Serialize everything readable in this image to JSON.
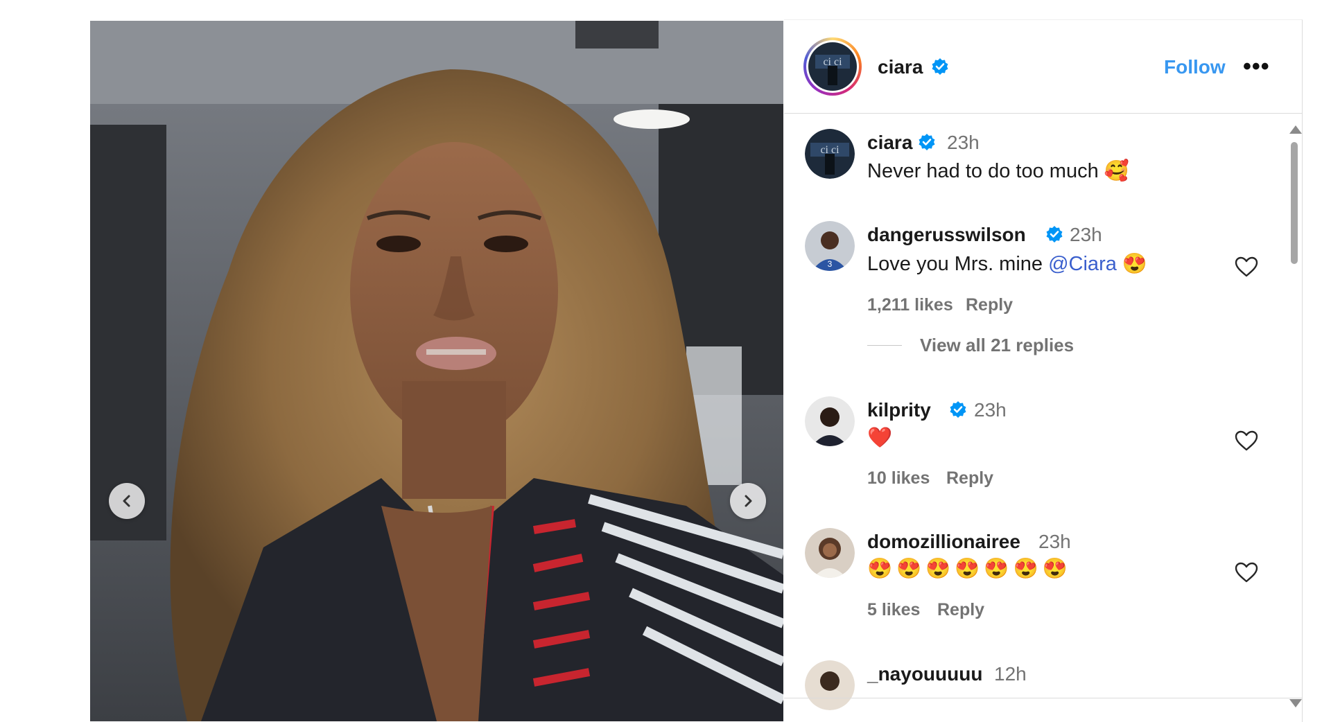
{
  "post": {
    "author": "ciara",
    "follow_label": "Follow",
    "more_label": "•••"
  },
  "comments": [
    {
      "user": "ciara",
      "time": "23h",
      "text": "Never had to do too much",
      "emoji": "🥰",
      "verified": true
    },
    {
      "user": "dangerusswilson",
      "time": "23h",
      "text": "Love you Mrs. mine",
      "mention": "@Ciara",
      "emoji": "😍",
      "verified": true,
      "likes": "1,211 likes",
      "reply": "Reply",
      "view_replies": "View all 21 replies"
    },
    {
      "user": "kilprity",
      "time": "23h",
      "emoji": "❤️",
      "verified": true,
      "likes": "10 likes",
      "reply": "Reply"
    },
    {
      "user": "domozillionairee",
      "time": "23h",
      "emoji": "😍😍😍😍😍😍😍",
      "verified": false,
      "likes": "5 likes",
      "reply": "Reply"
    },
    {
      "user": "_nayouuuuu",
      "time": "12h",
      "verified": false
    }
  ],
  "colors": {
    "accent": "#3897f0",
    "verified": "#0095f6",
    "muted": "#737373",
    "border": "#dbdbdb",
    "mention": "#3a5fcd"
  },
  "icons": {
    "verified": "verified-badge-icon",
    "heart": "heart-outline-icon",
    "prev": "chevron-left-icon",
    "next": "chevron-right-icon"
  }
}
